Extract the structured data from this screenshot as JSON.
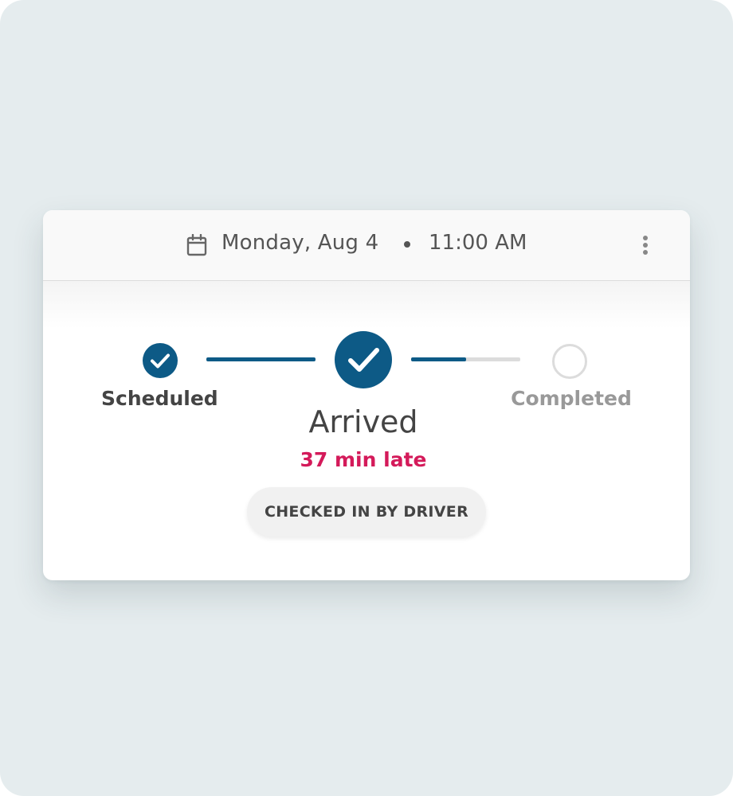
{
  "header": {
    "icon": "calendar-icon",
    "date": "Monday, Aug 4",
    "separator": "•",
    "time": "11:00 AM",
    "menu_icon": "more-vertical-icon"
  },
  "stepper": {
    "steps": [
      {
        "label": "Scheduled",
        "state": "done",
        "icon": "check-icon"
      },
      {
        "label": "Arrived",
        "state": "current",
        "icon": "check-icon"
      },
      {
        "label": "Completed",
        "state": "pending",
        "icon": "empty-circle-icon"
      }
    ],
    "connectors": [
      {
        "progress": 1.0
      },
      {
        "progress": 0.5
      }
    ],
    "status_note": "37 min late"
  },
  "badge": {
    "label": "CHECKED IN BY DRIVER"
  },
  "colors": {
    "accent": "#0d5a86",
    "late": "#d41a5a",
    "muted": "#999999",
    "text": "#444444",
    "background": "#e5ecee"
  }
}
